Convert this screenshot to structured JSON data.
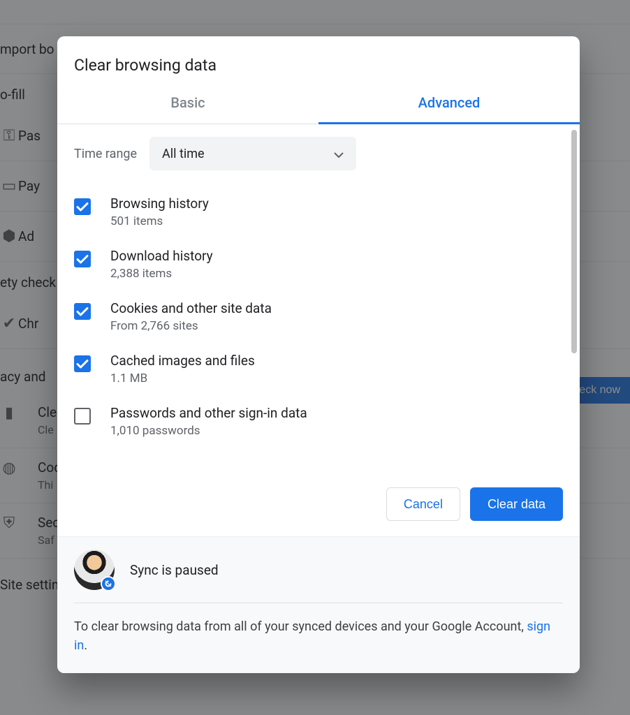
{
  "background": {
    "import": "mport bo",
    "autofill": "o-fill",
    "pass": "Pas",
    "pay": "Pay",
    "addr": "Ad",
    "safety": "ety check",
    "chr": "Chr",
    "checknow": "heck now",
    "privacy": "acy and",
    "clear_t": "Cle",
    "clear_s": "Cle",
    "cookies_t": "Cod",
    "cookies_s": "Thi",
    "sec_t": "Sec",
    "sec_s": "Saf",
    "site": "Site settings"
  },
  "dialog": {
    "title": "Clear browsing data",
    "tabs": {
      "basic": "Basic",
      "advanced": "Advanced"
    },
    "time_range_label": "Time range",
    "time_range_value": "All time",
    "options": [
      {
        "checked": true,
        "title": "Browsing history",
        "sub": "501 items"
      },
      {
        "checked": true,
        "title": "Download history",
        "sub": "2,388 items"
      },
      {
        "checked": true,
        "title": "Cookies and other site data",
        "sub": "From 2,766 sites"
      },
      {
        "checked": true,
        "title": "Cached images and files",
        "sub": "1.1 MB"
      },
      {
        "checked": false,
        "title": "Passwords and other sign-in data",
        "sub": "1,010 passwords"
      }
    ],
    "cancel": "Cancel",
    "clear": "Clear data",
    "sync_status": "Sync is paused",
    "sync_message_pre": "To clear browsing data from all of your synced devices and your Google Account, ",
    "sign_in": "sign in",
    "period": "."
  }
}
